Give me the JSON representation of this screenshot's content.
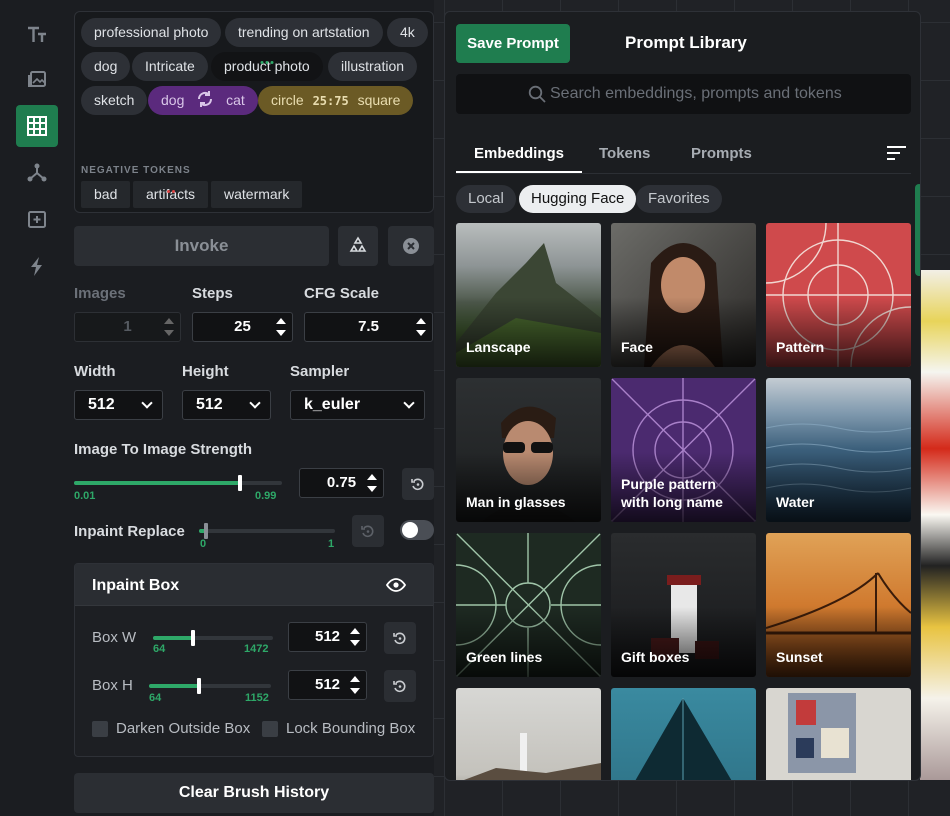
{
  "tokens": {
    "positive_row1": [
      "professional photo",
      "trending on artstation",
      "4k"
    ],
    "positive_row2": [
      "dog",
      "Intricate",
      "product photo",
      "illustration"
    ],
    "row3_sketch": "sketch",
    "blend": {
      "a": "dog",
      "b": "cat"
    },
    "ratio": {
      "a": "circle",
      "value": "25:75",
      "b": "square"
    },
    "negative_label": "NEGATIVE TOKENS",
    "negative": [
      "bad",
      "artifacts",
      "watermark"
    ]
  },
  "invoke_label": "Invoke",
  "params": {
    "images_label": "Images",
    "images_value": "1",
    "steps_label": "Steps",
    "steps_value": "25",
    "cfg_label": "CFG Scale",
    "cfg_value": "7.5",
    "width_label": "Width",
    "width_value": "512",
    "height_label": "Height",
    "height_value": "512",
    "sampler_label": "Sampler",
    "sampler_value": "k_euler"
  },
  "img2img": {
    "label": "Image To Image Strength",
    "min": "0.01",
    "max": "0.99",
    "value": "0.75",
    "fraction": 0.8
  },
  "inpaint_replace": {
    "label": "Inpaint Replace",
    "min": "0",
    "max": "1",
    "fraction": 0.05
  },
  "inpaint_box": {
    "title": "Inpaint Box",
    "box_w_label": "Box W",
    "box_w_min": "64",
    "box_w_max": "1472",
    "box_w_value": "512",
    "box_w_fraction": 0.33,
    "box_h_label": "Box H",
    "box_h_min": "64",
    "box_h_max": "1152",
    "box_h_value": "512",
    "box_h_fraction": 0.41,
    "darken_label": "Darken Outside Box",
    "lock_label": "Lock Bounding Box"
  },
  "clear_brush_label": "Clear Brush History",
  "library": {
    "save_label": "Save Prompt",
    "title": "Prompt Library",
    "search_placeholder": "Search embeddings, prompts and tokens",
    "tabs": [
      "Embeddings",
      "Tokens",
      "Prompts"
    ],
    "filters": [
      "Local",
      "Hugging Face",
      "Favorites"
    ],
    "cards": [
      "Lanscape",
      "Face",
      "Pattern",
      "Man in glasses",
      "Purple pattern with long name",
      "Water",
      "Green lines",
      "Gift boxes",
      "Sunset"
    ]
  },
  "accent_color": "#1f7d4f",
  "rail_icons": [
    "text-icon",
    "image-icon",
    "grid-icon",
    "nodes-icon",
    "add-image-icon",
    "bolt-icon"
  ]
}
